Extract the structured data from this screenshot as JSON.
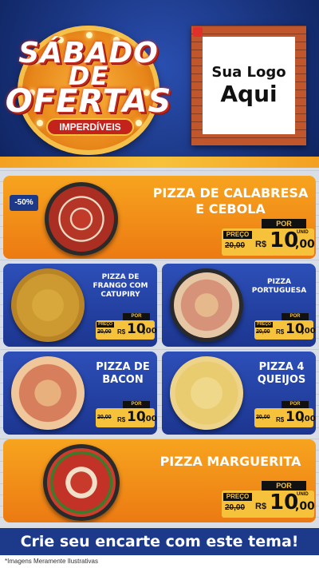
{
  "header": {
    "title_line1": "SÁBADO",
    "title_line2": "DE",
    "title_line3": "OFERTAS",
    "subtitle": "IMPERDÍVEIS",
    "logo_line1": "Sua Logo",
    "logo_line2": "Aqui"
  },
  "labels": {
    "por": "POR",
    "preco": "PREÇO",
    "currency": "R$",
    "unid": "UNID"
  },
  "products": [
    {
      "name_line1": "PIZZA DE CALABRESA",
      "name_line2": "E CEBOLA",
      "discount": "-50%",
      "old_price": "20,00",
      "price_int": "10",
      "price_dec": ",00",
      "pizza_icon": "pizza-calabresa"
    },
    {
      "name_line1": "PIZZA DE",
      "name_line2": "FRANGO COM",
      "name_line3": "CATUPIRY",
      "old_price": "20,00",
      "price_int": "10",
      "price_dec": ",00",
      "pizza_icon": "pizza-frango"
    },
    {
      "name_line1": "PIZZA",
      "name_line2": "PORTUGUESA",
      "old_price": "20,00",
      "price_int": "10",
      "price_dec": ",00",
      "pizza_icon": "pizza-portuguesa"
    },
    {
      "name_line1": "PIZZA DE",
      "name_line2": "BACON",
      "old_price": "20,00",
      "price_int": "10",
      "price_dec": ",00",
      "pizza_icon": "pizza-bacon"
    },
    {
      "name_line1": "PIZZA 4",
      "name_line2": "QUEIJOS",
      "old_price": "20,00",
      "price_int": "10",
      "price_dec": ",00",
      "pizza_icon": "pizza-queijos"
    },
    {
      "name_line1": "PIZZA MARGUERITA",
      "old_price": "20,00",
      "price_int": "10",
      "price_dec": ",00",
      "pizza_icon": "pizza-marguerita"
    }
  ],
  "footer": {
    "cta": "Crie seu encarte com este tema!",
    "disclaimer": "*Imagens Meramente Ilustrativas"
  },
  "colors": {
    "brand_blue": "#1d3a8a",
    "brand_orange": "#f4a021",
    "price_yellow": "#f7c23b",
    "title_red": "#c4231c"
  }
}
